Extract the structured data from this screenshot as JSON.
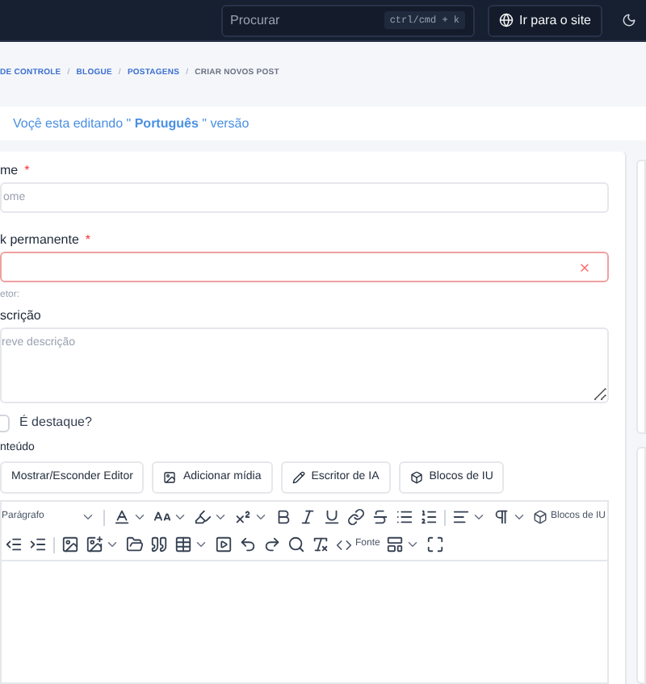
{
  "header": {
    "search": {
      "placeholder": "Procurar",
      "shortcut": "ctrl/cmd + k"
    },
    "site_button": "Ir para o site"
  },
  "breadcrumb": [
    {
      "kind": "link",
      "label": "DE CONTROLE"
    },
    {
      "kind": "separator",
      "label": "/"
    },
    {
      "kind": "link",
      "label": "BLOGUE"
    },
    {
      "kind": "separator",
      "label": "/"
    },
    {
      "kind": "link",
      "label": "POSTAGENS"
    },
    {
      "kind": "separator",
      "label": "/"
    },
    {
      "kind": "current",
      "label": "CRIAR NOVOS POST"
    }
  ],
  "banner": "Voçê esta editando \" **Português** \" versão",
  "form": {
    "name": {
      "label": "me",
      "required_mark": "*",
      "placeholder": "ome",
      "invalid": false
    },
    "permalink": {
      "label": "k permanente",
      "required_mark": "*",
      "invalid": true,
      "hint": "etor:"
    },
    "description": {
      "label": "scrição",
      "placeholder": "reve descrição"
    },
    "featured": {
      "label": "É destaque?",
      "checked": false
    },
    "content_label": "nteúdo",
    "buttons": [
      "Mostrar/Esconder Editor",
      "Adicionar mídia",
      "Escritor de IA",
      "Blocos de IU"
    ],
    "toolbar": {
      "format_select": "Parágrafo",
      "blocks_button": "Blocos de IU",
      "source_button": "Fonte"
    }
  }
}
